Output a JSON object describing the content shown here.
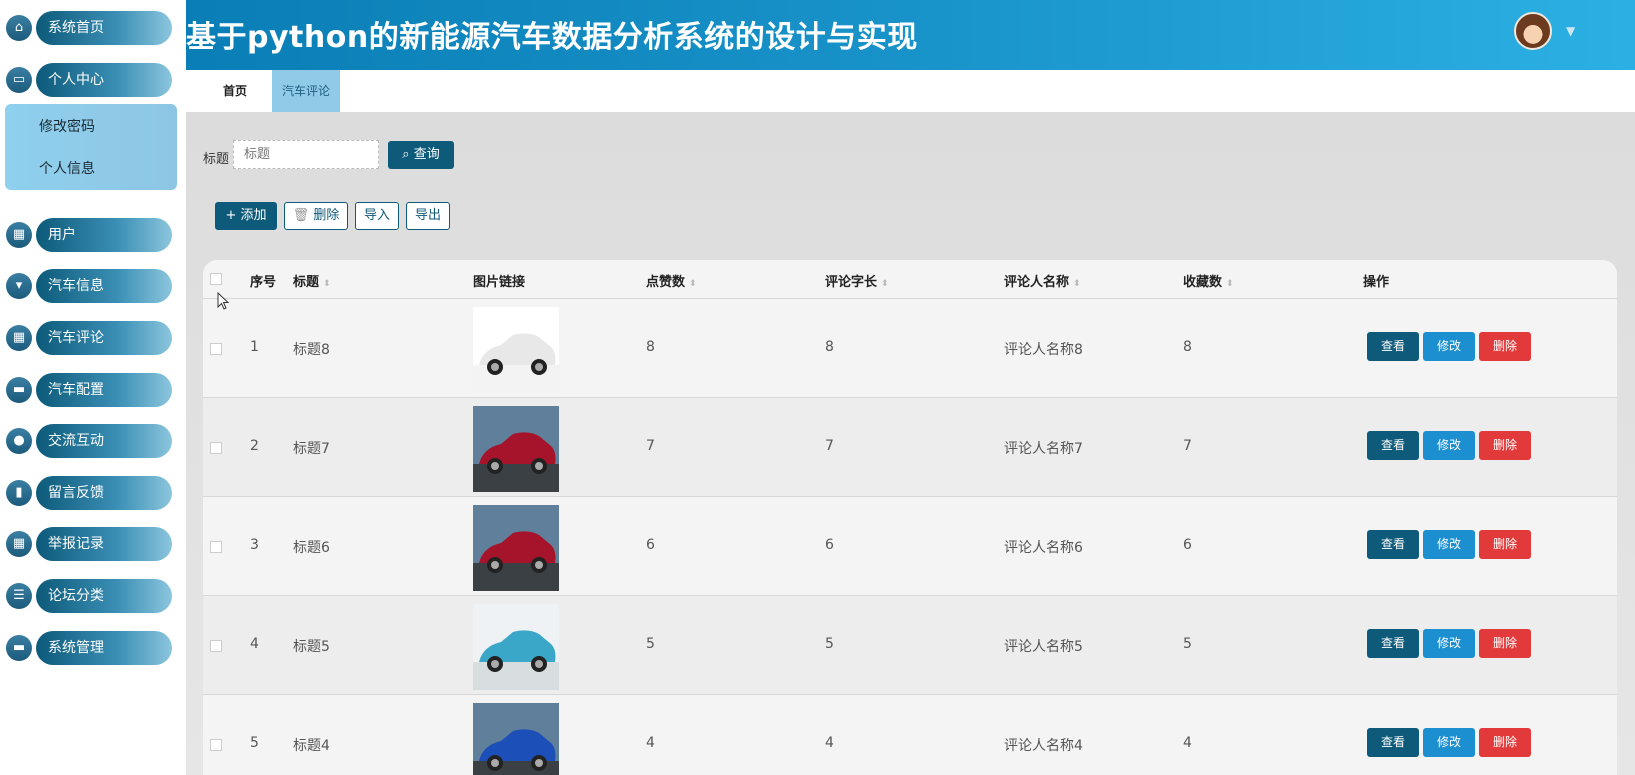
{
  "header": {
    "title": "基于python的新能源汽车数据分析系统的设计与实现"
  },
  "sidebar": {
    "items": [
      {
        "label": "系统首页",
        "icon": "home-icon"
      },
      {
        "label": "个人中心",
        "icon": "wallet-icon"
      },
      {
        "label": "用户",
        "icon": "grid-icon"
      },
      {
        "label": "汽车信息",
        "icon": "pin-icon"
      },
      {
        "label": "汽车评论",
        "icon": "grid-icon"
      },
      {
        "label": "汽车配置",
        "icon": "monitor-icon"
      },
      {
        "label": "交流互动",
        "icon": "bulb-icon"
      },
      {
        "label": "留言反馈",
        "icon": "bar-chart-icon"
      },
      {
        "label": "举报记录",
        "icon": "grid-icon"
      },
      {
        "label": "论坛分类",
        "icon": "list-icon"
      },
      {
        "label": "系统管理",
        "icon": "device-icon"
      }
    ],
    "submenu": [
      "修改密码",
      "个人信息"
    ]
  },
  "tabs": [
    {
      "label": "首页"
    },
    {
      "label": "汽车评论"
    }
  ],
  "search": {
    "label": "标题",
    "placeholder": "标题",
    "query_button": "查询"
  },
  "toolbar": {
    "add": "添加",
    "delete": "删除",
    "import": "导入",
    "export": "导出"
  },
  "table": {
    "headers": [
      "序号",
      "标题",
      "图片链接",
      "点赞数",
      "评论字长",
      "评论人名称",
      "收藏数",
      "操作"
    ],
    "actions": {
      "view": "查看",
      "edit": "修改",
      "delete": "删除"
    },
    "rows": [
      {
        "index": "1",
        "title": "标题8",
        "likes": "8",
        "length": "8",
        "commenter": "评论人名称8",
        "favorites": "8",
        "car_color": "#e8e8e8"
      },
      {
        "index": "2",
        "title": "标题7",
        "likes": "7",
        "length": "7",
        "commenter": "评论人名称7",
        "favorites": "7",
        "car_color": "#a5142a"
      },
      {
        "index": "3",
        "title": "标题6",
        "likes": "6",
        "length": "6",
        "commenter": "评论人名称6",
        "favorites": "6",
        "car_color": "#a5142a"
      },
      {
        "index": "4",
        "title": "标题5",
        "likes": "5",
        "length": "5",
        "commenter": "评论人名称5",
        "favorites": "5",
        "car_color": "#3aa7c9"
      },
      {
        "index": "5",
        "title": "标题4",
        "likes": "4",
        "length": "4",
        "commenter": "评论人名称4",
        "favorites": "4",
        "car_color": "#1d4fb8"
      }
    ]
  },
  "colors": {
    "accent": "#0d5a7a",
    "edit": "#1b8fd0",
    "danger": "#e23a3a",
    "header": "#1893c9"
  }
}
